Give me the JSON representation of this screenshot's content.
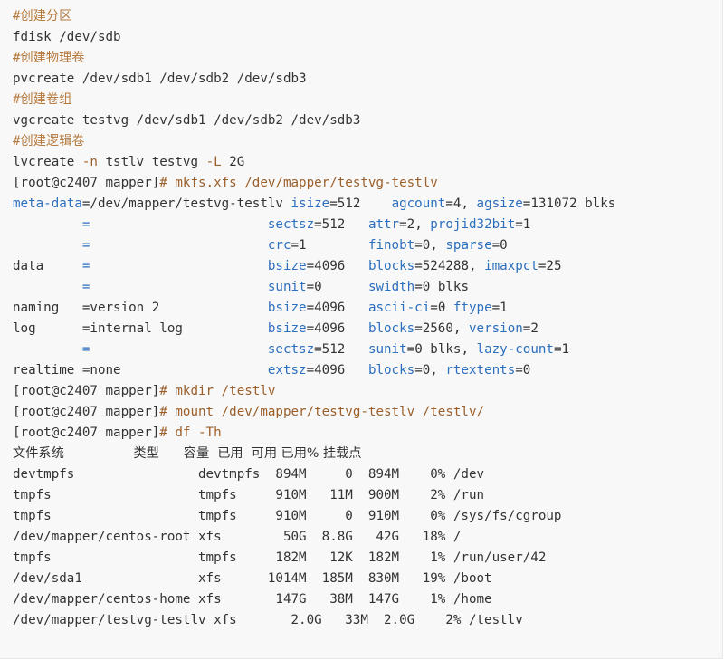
{
  "code_lines": [
    [
      {
        "t": "#创建分区",
        "c": "cm"
      }
    ],
    [
      {
        "t": "fdisk /dev/sdb",
        "c": "plain"
      }
    ],
    [
      {
        "t": "#创建物理卷",
        "c": "cm"
      }
    ],
    [
      {
        "t": "pvcreate /dev/sdb1 /dev/sdb2 /dev/sdb3",
        "c": "plain"
      }
    ],
    [
      {
        "t": "#创建卷组",
        "c": "cm"
      }
    ],
    [
      {
        "t": "vgcreate testvg /dev/sdb1 /dev/sdb2 /dev/sdb3",
        "c": "plain"
      }
    ],
    [
      {
        "t": "#创建逻辑卷",
        "c": "cm"
      }
    ],
    [
      {
        "t": "lvcreate ",
        "c": "plain"
      },
      {
        "t": "-n",
        "c": "op"
      },
      {
        "t": " tstlv testvg ",
        "c": "plain"
      },
      {
        "t": "-L",
        "c": "op"
      },
      {
        "t": " 2G",
        "c": "plain"
      }
    ],
    [
      {
        "t": "[root@c2407 mapper]",
        "c": "plain"
      },
      {
        "t": "# mkfs.xfs /dev/mapper/testvg-testlv",
        "c": "cmd"
      }
    ],
    [
      {
        "t": "meta-data",
        "c": "kw"
      },
      {
        "t": "=/dev/mapper/testvg-testlv ",
        "c": "plain"
      },
      {
        "t": "isize",
        "c": "kw"
      },
      {
        "t": "=512    ",
        "c": "plain"
      },
      {
        "t": "agcount",
        "c": "kw"
      },
      {
        "t": "=4, ",
        "c": "plain"
      },
      {
        "t": "agsize",
        "c": "kw"
      },
      {
        "t": "=131072 blks",
        "c": "plain"
      }
    ],
    [
      {
        "t": "         ",
        "c": "plain"
      },
      {
        "t": "=",
        "c": "kw"
      },
      {
        "t": "                       ",
        "c": "plain"
      },
      {
        "t": "sectsz",
        "c": "kw"
      },
      {
        "t": "=512   ",
        "c": "plain"
      },
      {
        "t": "attr",
        "c": "kw"
      },
      {
        "t": "=2, ",
        "c": "plain"
      },
      {
        "t": "projid32bit",
        "c": "kw"
      },
      {
        "t": "=1",
        "c": "plain"
      }
    ],
    [
      {
        "t": "         ",
        "c": "plain"
      },
      {
        "t": "=",
        "c": "kw"
      },
      {
        "t": "                       ",
        "c": "plain"
      },
      {
        "t": "crc",
        "c": "kw"
      },
      {
        "t": "=1        ",
        "c": "plain"
      },
      {
        "t": "finobt",
        "c": "kw"
      },
      {
        "t": "=0, ",
        "c": "plain"
      },
      {
        "t": "sparse",
        "c": "kw"
      },
      {
        "t": "=0",
        "c": "plain"
      }
    ],
    [
      {
        "t": "data     ",
        "c": "plain"
      },
      {
        "t": "=",
        "c": "kw"
      },
      {
        "t": "                       ",
        "c": "plain"
      },
      {
        "t": "bsize",
        "c": "kw"
      },
      {
        "t": "=4096   ",
        "c": "plain"
      },
      {
        "t": "blocks",
        "c": "kw"
      },
      {
        "t": "=524288, ",
        "c": "plain"
      },
      {
        "t": "imaxpct",
        "c": "kw"
      },
      {
        "t": "=25",
        "c": "plain"
      }
    ],
    [
      {
        "t": "         ",
        "c": "plain"
      },
      {
        "t": "=",
        "c": "kw"
      },
      {
        "t": "                       ",
        "c": "plain"
      },
      {
        "t": "sunit",
        "c": "kw"
      },
      {
        "t": "=0      ",
        "c": "plain"
      },
      {
        "t": "swidth",
        "c": "kw"
      },
      {
        "t": "=0 blks",
        "c": "plain"
      }
    ],
    [
      {
        "t": "naming   =version 2              ",
        "c": "plain"
      },
      {
        "t": "bsize",
        "c": "kw"
      },
      {
        "t": "=4096   ",
        "c": "plain"
      },
      {
        "t": "ascii-ci",
        "c": "kw"
      },
      {
        "t": "=0 ",
        "c": "plain"
      },
      {
        "t": "ftype",
        "c": "kw"
      },
      {
        "t": "=1",
        "c": "plain"
      }
    ],
    [
      {
        "t": "log      =internal log           ",
        "c": "plain"
      },
      {
        "t": "bsize",
        "c": "kw"
      },
      {
        "t": "=4096   ",
        "c": "plain"
      },
      {
        "t": "blocks",
        "c": "kw"
      },
      {
        "t": "=2560, ",
        "c": "plain"
      },
      {
        "t": "version",
        "c": "kw"
      },
      {
        "t": "=2",
        "c": "plain"
      }
    ],
    [
      {
        "t": "         ",
        "c": "plain"
      },
      {
        "t": "=",
        "c": "kw"
      },
      {
        "t": "                       ",
        "c": "plain"
      },
      {
        "t": "sectsz",
        "c": "kw"
      },
      {
        "t": "=512   ",
        "c": "plain"
      },
      {
        "t": "sunit",
        "c": "kw"
      },
      {
        "t": "=0 blks, ",
        "c": "plain"
      },
      {
        "t": "lazy-count",
        "c": "kw"
      },
      {
        "t": "=1",
        "c": "plain"
      }
    ],
    [
      {
        "t": "realtime =none                   ",
        "c": "plain"
      },
      {
        "t": "extsz",
        "c": "kw"
      },
      {
        "t": "=4096   ",
        "c": "plain"
      },
      {
        "t": "blocks",
        "c": "kw"
      },
      {
        "t": "=0, ",
        "c": "plain"
      },
      {
        "t": "rtextents",
        "c": "kw"
      },
      {
        "t": "=0",
        "c": "plain"
      }
    ],
    [
      {
        "t": "[root@c2407 mapper]",
        "c": "plain"
      },
      {
        "t": "# mkdir /testlv",
        "c": "cmd"
      }
    ],
    [
      {
        "t": "[root@c2407 mapper]",
        "c": "plain"
      },
      {
        "t": "# mount /dev/mapper/testvg-testlv /testlv/",
        "c": "cmd"
      }
    ],
    [
      {
        "t": "[root@c2407 mapper]",
        "c": "plain"
      },
      {
        "t": "# df -Th",
        "c": "cmd"
      }
    ],
    [
      {
        "t": "文件系统                 类型      容量  已用  可用 已用% 挂载点",
        "c": "plain cjk"
      }
    ],
    [
      {
        "t": "devtmpfs                devtmpfs  894M     0  894M    0% /dev",
        "c": "plain"
      }
    ],
    [
      {
        "t": "tmpfs                   tmpfs     910M   11M  900M    2% /run",
        "c": "plain"
      }
    ],
    [
      {
        "t": "tmpfs                   tmpfs     910M     0  910M    0% /sys/fs/cgroup",
        "c": "plain"
      }
    ],
    [
      {
        "t": "/dev/mapper/centos-root xfs        50G  8.8G   42G   18% /",
        "c": "plain"
      }
    ],
    [
      {
        "t": "tmpfs                   tmpfs     182M   12K  182M    1% /run/user/42",
        "c": "plain"
      }
    ],
    [
      {
        "t": "/dev/sda1               xfs      1014M  185M  830M   19% /boot",
        "c": "plain"
      }
    ],
    [
      {
        "t": "/dev/mapper/centos-home xfs       147G   38M  147G    1% /home",
        "c": "plain"
      }
    ],
    [
      {
        "t": "/dev/mapper/testvg-testlv xfs       2.0G   33M  2.0G    2% /testlv",
        "c": "plain"
      }
    ]
  ],
  "colors": {
    "background": "#f8f8f8",
    "text": "#333333",
    "comment": "#b5793e",
    "keyword": "#2c6fbd"
  }
}
